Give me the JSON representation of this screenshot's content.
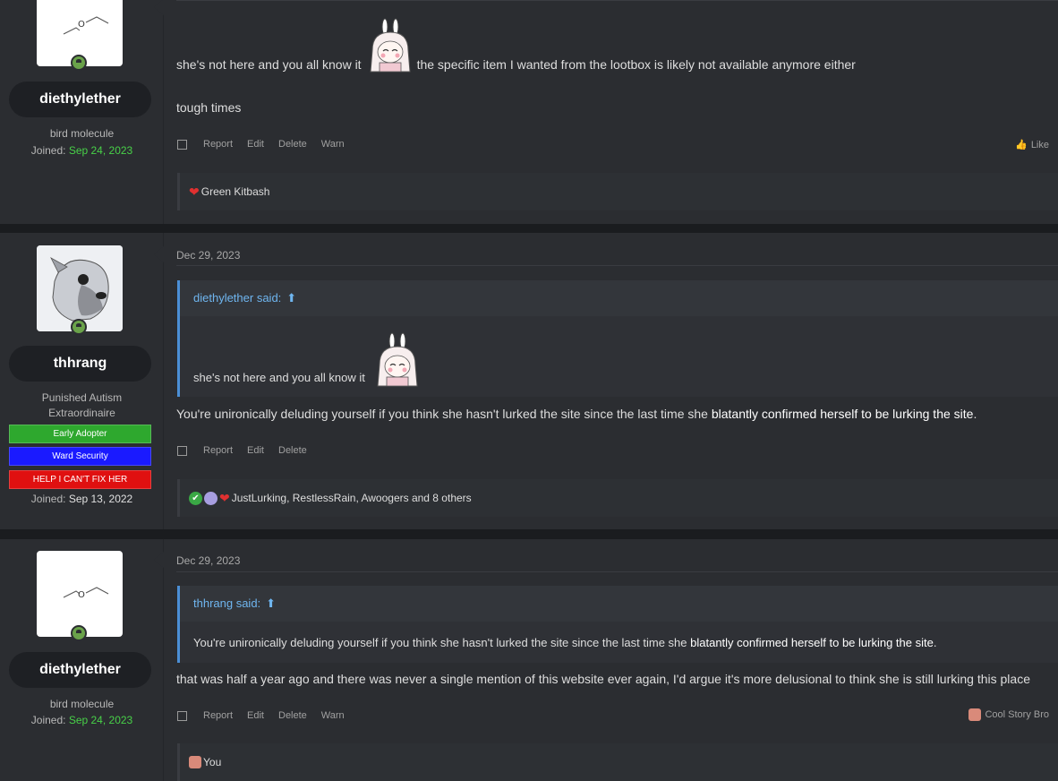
{
  "posts": [
    {
      "user": {
        "name": "diethylether",
        "title": "bird molecule",
        "joined_label": "Joined:",
        "joined_date": "Sep 24, 2023"
      },
      "body": {
        "line1_before": "she's not here and you all know it ",
        "line1_after": " the specific item I wanted from the lootbox is likely not available anymore either",
        "line2": "tough times"
      },
      "actions": {
        "report": "Report",
        "edit": "Edit",
        "delete": "Delete",
        "warn": "Warn",
        "like": "Like"
      },
      "reactions": {
        "names": "Green Kitbash"
      }
    },
    {
      "user": {
        "name": "thhrang",
        "title": "Punished Autism Extraordinaire",
        "banners": [
          "Early Adopter",
          "Ward Security",
          "HELP I CAN'T FIX HER"
        ],
        "joined_label": "Joined:",
        "joined_date": "Sep 13, 2022"
      },
      "date": "Dec 29, 2023",
      "quote": {
        "author": "diethylether said:",
        "text": "she's not here and you all know it"
      },
      "body": {
        "text_before": "You're unironically deluding yourself if you think she hasn't lurked the site since the last time she ",
        "link": "blatantly confirmed herself to be lurking the site",
        "text_after": "."
      },
      "actions": {
        "report": "Report",
        "edit": "Edit",
        "delete": "Delete"
      },
      "reactions": {
        "names": "JustLurking, RestlessRain, Awoogers and 8 others"
      }
    },
    {
      "user": {
        "name": "diethylether",
        "title": "bird molecule",
        "joined_label": "Joined:",
        "joined_date": "Sep 24, 2023"
      },
      "date": "Dec 29, 2023",
      "quote": {
        "author": "thhrang said:",
        "text_before": "You're unironically deluding yourself if you think she hasn't lurked the site since the last time she ",
        "link": "blatantly confirmed herself to be lurking the site",
        "text_after": "."
      },
      "body": {
        "text": "that was half a year ago and there was never a single mention of this website ever again, I'd argue it's more delusional to think she is still lurking this place"
      },
      "actions": {
        "report": "Report",
        "edit": "Edit",
        "delete": "Delete",
        "warn": "Warn",
        "reaction": "Cool Story Bro"
      },
      "reactions": {
        "names": "You"
      }
    }
  ],
  "colors": {
    "online": "#6aa24a",
    "joined_green": "#48d148",
    "banner_green": "#2ea82e",
    "banner_blue": "#1a1aff",
    "banner_red": "#e01010",
    "quote_link": "#6fb6f0"
  }
}
